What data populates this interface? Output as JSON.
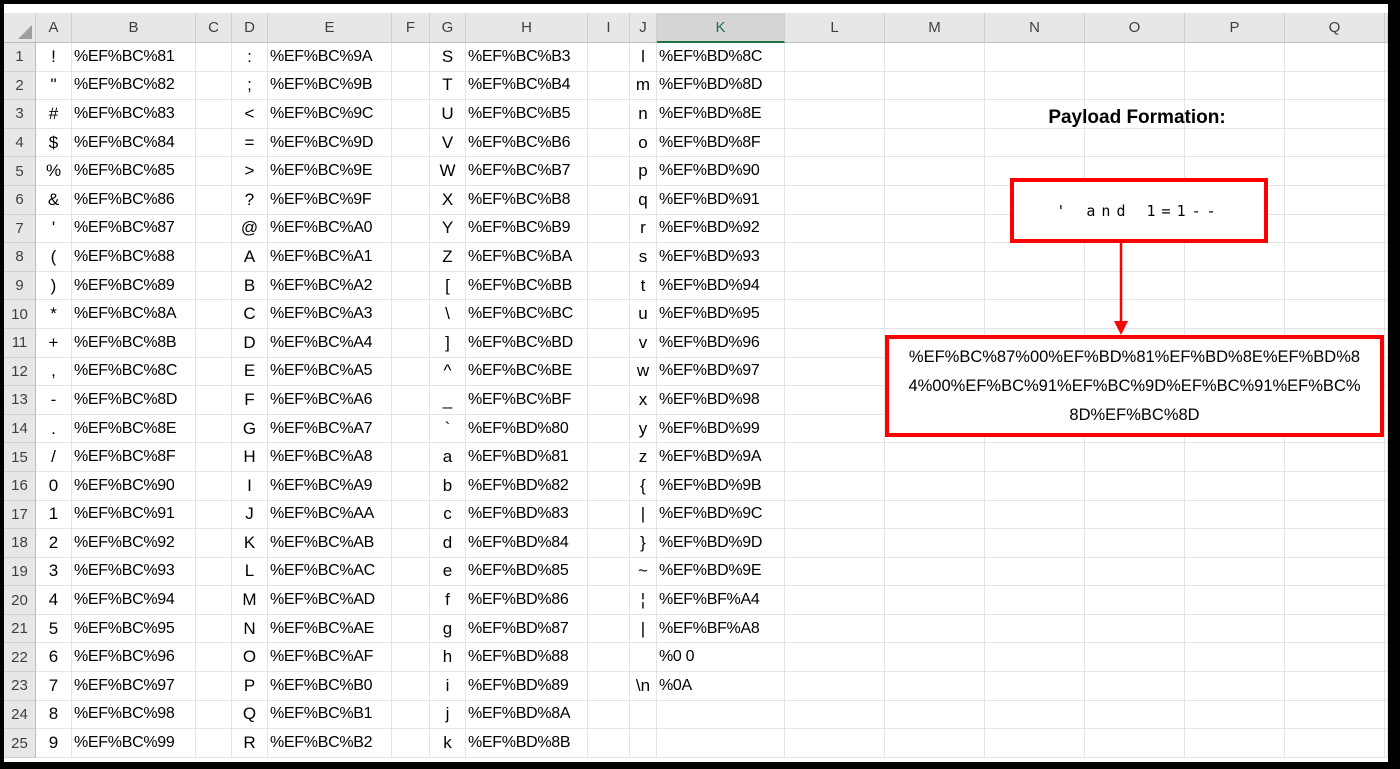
{
  "sheet": {
    "column_headers": [
      "A",
      "B",
      "C",
      "D",
      "E",
      "F",
      "G",
      "H",
      "I",
      "J",
      "K",
      "L",
      "M",
      "N",
      "O",
      "P",
      "Q"
    ],
    "selected_column": "K",
    "rows": [
      {
        "n": "1",
        "A": "!",
        "B": "%EF%BC%81",
        "D": ":",
        "E": "%EF%BC%9A",
        "G": "S",
        "H": "%EF%BC%B3",
        "J": "l",
        "K": "%EF%BD%8C"
      },
      {
        "n": "2",
        "A": "\"",
        "B": "%EF%BC%82",
        "D": ";",
        "E": "%EF%BC%9B",
        "G": "T",
        "H": "%EF%BC%B4",
        "J": "m",
        "K": "%EF%BD%8D"
      },
      {
        "n": "3",
        "A": "#",
        "B": "%EF%BC%83",
        "D": "<",
        "E": "%EF%BC%9C",
        "G": "U",
        "H": "%EF%BC%B5",
        "J": "n",
        "K": "%EF%BD%8E"
      },
      {
        "n": "4",
        "A": "$",
        "B": "%EF%BC%84",
        "D": "=",
        "E": "%EF%BC%9D",
        "G": "V",
        "H": "%EF%BC%B6",
        "J": "o",
        "K": "%EF%BD%8F"
      },
      {
        "n": "5",
        "A": "%",
        "B": "%EF%BC%85",
        "D": ">",
        "E": "%EF%BC%9E",
        "G": "W",
        "H": "%EF%BC%B7",
        "J": "p",
        "K": "%EF%BD%90"
      },
      {
        "n": "6",
        "A": "&",
        "B": "%EF%BC%86",
        "D": "?",
        "E": "%EF%BC%9F",
        "G": "X",
        "H": "%EF%BC%B8",
        "J": "q",
        "K": "%EF%BD%91"
      },
      {
        "n": "7",
        "A": "'",
        "B": "%EF%BC%87",
        "D": "@",
        "E": "%EF%BC%A0",
        "G": "Y",
        "H": "%EF%BC%B9",
        "J": "r",
        "K": "%EF%BD%92"
      },
      {
        "n": "8",
        "A": "(",
        "B": "%EF%BC%88",
        "D": "A",
        "E": "%EF%BC%A1",
        "G": "Z",
        "H": "%EF%BC%BA",
        "J": "s",
        "K": "%EF%BD%93"
      },
      {
        "n": "9",
        "A": ")",
        "B": "%EF%BC%89",
        "D": "B",
        "E": "%EF%BC%A2",
        "G": "[",
        "H": "%EF%BC%BB",
        "J": "t",
        "K": "%EF%BD%94"
      },
      {
        "n": "10",
        "A": "*",
        "B": "%EF%BC%8A",
        "D": "C",
        "E": "%EF%BC%A3",
        "G": "\\",
        "H": "%EF%BC%BC",
        "J": "u",
        "K": "%EF%BD%95"
      },
      {
        "n": "11",
        "A": "+",
        "B": "%EF%BC%8B",
        "D": "D",
        "E": "%EF%BC%A4",
        "G": "]",
        "H": "%EF%BC%BD",
        "J": "v",
        "K": "%EF%BD%96"
      },
      {
        "n": "12",
        "A": ",",
        "B": "%EF%BC%8C",
        "D": "E",
        "E": "%EF%BC%A5",
        "G": "^",
        "H": "%EF%BC%BE",
        "J": "w",
        "K": "%EF%BD%97"
      },
      {
        "n": "13",
        "A": "-",
        "B": "%EF%BC%8D",
        "D": "F",
        "E": "%EF%BC%A6",
        "G": "_",
        "H": "%EF%BC%BF",
        "J": "x",
        "K": "%EF%BD%98"
      },
      {
        "n": "14",
        "A": ".",
        "B": "%EF%BC%8E",
        "D": "G",
        "E": "%EF%BC%A7",
        "G": "`",
        "H": "%EF%BD%80",
        "J": "y",
        "K": "%EF%BD%99"
      },
      {
        "n": "15",
        "A": "/",
        "B": "%EF%BC%8F",
        "D": "H",
        "E": "%EF%BC%A8",
        "G": "a",
        "H": "%EF%BD%81",
        "J": "z",
        "K": "%EF%BD%9A"
      },
      {
        "n": "16",
        "A": "0",
        "B": "%EF%BC%90",
        "D": "I",
        "E": "%EF%BC%A9",
        "G": "b",
        "H": "%EF%BD%82",
        "J": "{",
        "K": "%EF%BD%9B"
      },
      {
        "n": "17",
        "A": "1",
        "B": "%EF%BC%91",
        "D": "J",
        "E": "%EF%BC%AA",
        "G": "c",
        "H": "%EF%BD%83",
        "J": "|",
        "K": "%EF%BD%9C"
      },
      {
        "n": "18",
        "A": "2",
        "B": "%EF%BC%92",
        "D": "K",
        "E": "%EF%BC%AB",
        "G": "d",
        "H": "%EF%BD%84",
        "J": "}",
        "K": "%EF%BD%9D"
      },
      {
        "n": "19",
        "A": "3",
        "B": "%EF%BC%93",
        "D": "L",
        "E": "%EF%BC%AC",
        "G": "e",
        "H": "%EF%BD%85",
        "J": "~",
        "K": "%EF%BD%9E"
      },
      {
        "n": "20",
        "A": "4",
        "B": "%EF%BC%94",
        "D": "M",
        "E": "%EF%BC%AD",
        "G": "f",
        "H": "%EF%BD%86",
        "J": "¦",
        "K": "%EF%BF%A4"
      },
      {
        "n": "21",
        "A": "5",
        "B": "%EF%BC%95",
        "D": "N",
        "E": "%EF%BC%AE",
        "G": "g",
        "H": "%EF%BD%87",
        "J": "|",
        "K": "%EF%BF%A8"
      },
      {
        "n": "22",
        "A": "6",
        "B": "%EF%BC%96",
        "D": "O",
        "E": "%EF%BC%AF",
        "G": "h",
        "H": "%EF%BD%88",
        "J": "",
        "K": "%0 0"
      },
      {
        "n": "23",
        "A": "7",
        "B": "%EF%BC%97",
        "D": "P",
        "E": "%EF%BC%B0",
        "G": "i",
        "H": "%EF%BD%89",
        "J": "\\n",
        "K": "%0A"
      },
      {
        "n": "24",
        "A": "8",
        "B": "%EF%BC%98",
        "D": "Q",
        "E": "%EF%BC%B1",
        "G": "j",
        "H": "%EF%BD%8A",
        "J": "",
        "K": ""
      },
      {
        "n": "25",
        "A": "9",
        "B": "%EF%BC%99",
        "D": "R",
        "E": "%EF%BC%B2",
        "G": "k",
        "H": "%EF%BD%8B",
        "J": "",
        "K": ""
      }
    ]
  },
  "annotation": {
    "title": "Payload Formation:",
    "source_text": "' and 1=1--",
    "payload_lines": {
      "0": "%EF%BC%87%00%EF%BD%81%EF%BD%8E%EF%BD%8",
      "1": "4%00%EF%BC%91%EF%BC%9D%EF%BC%91%EF%BC%",
      "2": "8D%EF%BC%8D"
    }
  },
  "colors": {
    "accent_red": "#FF0000",
    "selected_header_green": "#217346",
    "header_gray": "#E7E7E7"
  }
}
